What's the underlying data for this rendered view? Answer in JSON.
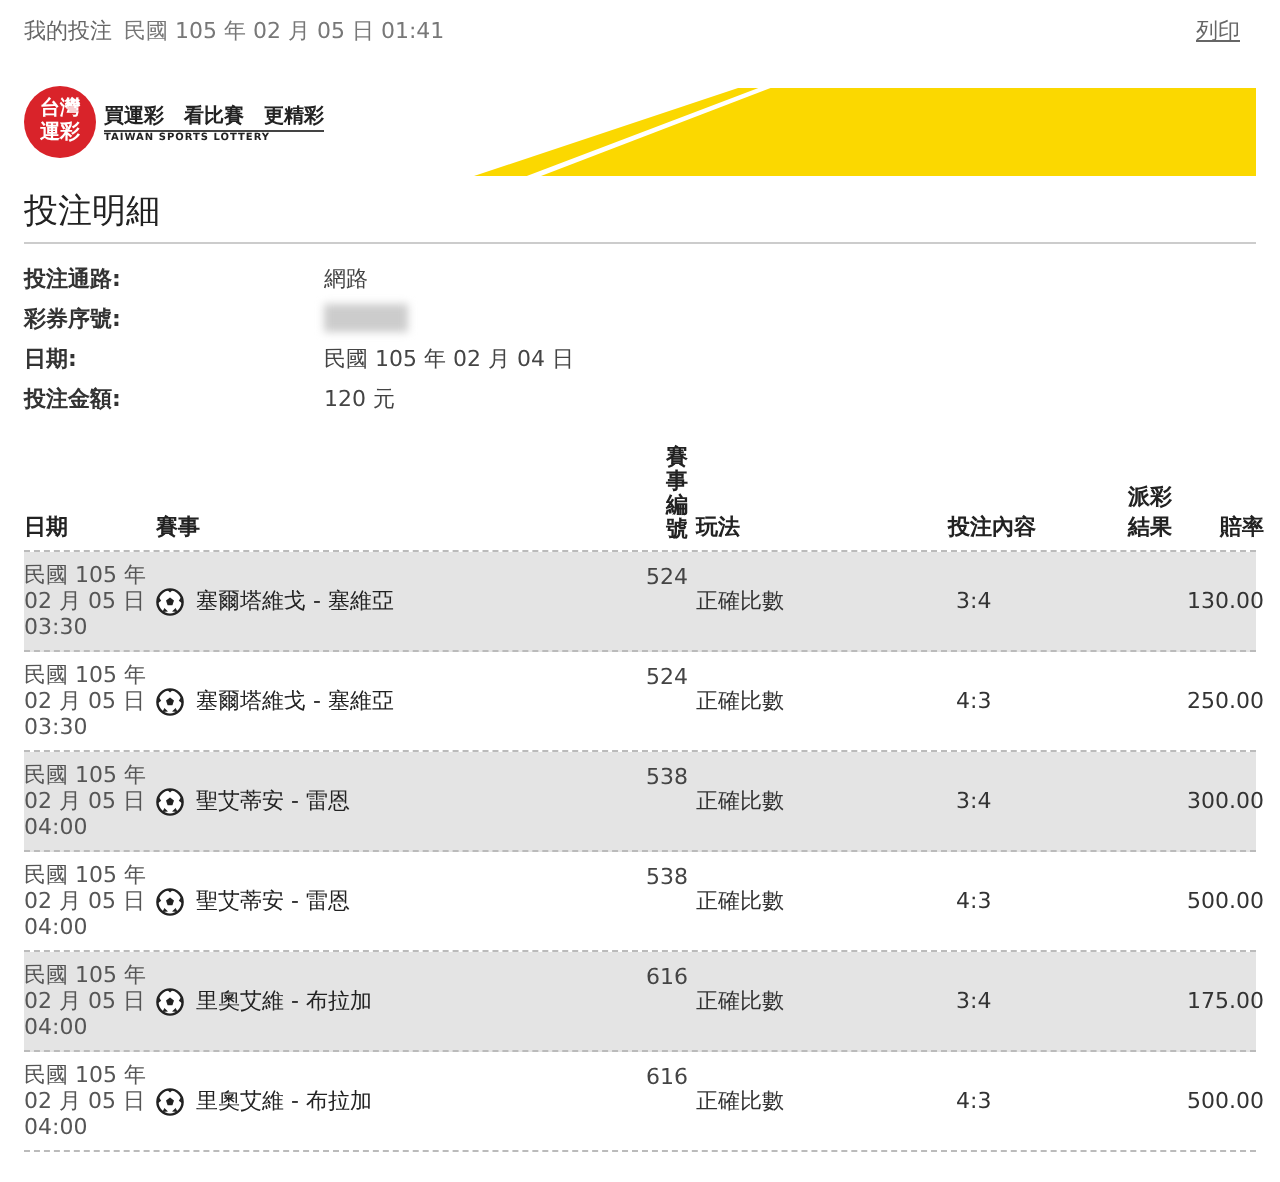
{
  "top_bar": {
    "title": "我的投注",
    "timestamp": "民國 105 年 02 月 05 日 01:41",
    "print_link": "列印"
  },
  "logo": {
    "mark": "台灣運彩",
    "slogan": "買運彩　看比賽　更精彩",
    "english": "TAIWAN SPORTS LOTTERY"
  },
  "section_title": "投注明細",
  "details": [
    {
      "label": "投注通路:",
      "value": "網路"
    },
    {
      "label": "彩券序號:",
      "kind": "blurred"
    },
    {
      "label": "日期:",
      "value": "民國 105 年 02 月 04 日"
    },
    {
      "label": "投注金額:",
      "value": "120 元"
    }
  ],
  "table": {
    "columns": [
      "日期",
      "賽事",
      "賽事編號",
      "玩法",
      "投注內容",
      "派彩結果",
      "賠率"
    ],
    "rows": [
      {
        "date": [
          "民國 105 年",
          "02 月 05 日",
          "03:30"
        ],
        "event": "塞爾塔維戈 - 塞維亞",
        "number": "524",
        "play": "正確比數",
        "pick": "3:4",
        "odds": "130.00"
      },
      {
        "date": [
          "民國 105 年",
          "02 月 05 日",
          "03:30"
        ],
        "event": "塞爾塔維戈 - 塞維亞",
        "number": "524",
        "play": "正確比數",
        "pick": "4:3",
        "odds": "250.00"
      },
      {
        "date": [
          "民國 105 年",
          "02 月 05 日",
          "04:00"
        ],
        "event": "聖艾蒂安 - 雷恩",
        "number": "538",
        "play": "正確比數",
        "pick": "3:4",
        "odds": "300.00"
      },
      {
        "date": [
          "民國 105 年",
          "02 月 05 日",
          "04:00"
        ],
        "event": "聖艾蒂安 - 雷恩",
        "number": "538",
        "play": "正確比數",
        "pick": "4:3",
        "odds": "500.00"
      },
      {
        "date": [
          "民國 105 年",
          "02 月 05 日",
          "04:00"
        ],
        "event": "里奧艾維 - 布拉加",
        "number": "616",
        "play": "正確比數",
        "pick": "3:4",
        "odds": "175.00"
      },
      {
        "date": [
          "民國 105 年",
          "02 月 05 日",
          "04:00"
        ],
        "event": "里奧艾維 - 布拉加",
        "number": "616",
        "play": "正確比數",
        "pick": "4:3",
        "odds": "500.00"
      }
    ]
  }
}
